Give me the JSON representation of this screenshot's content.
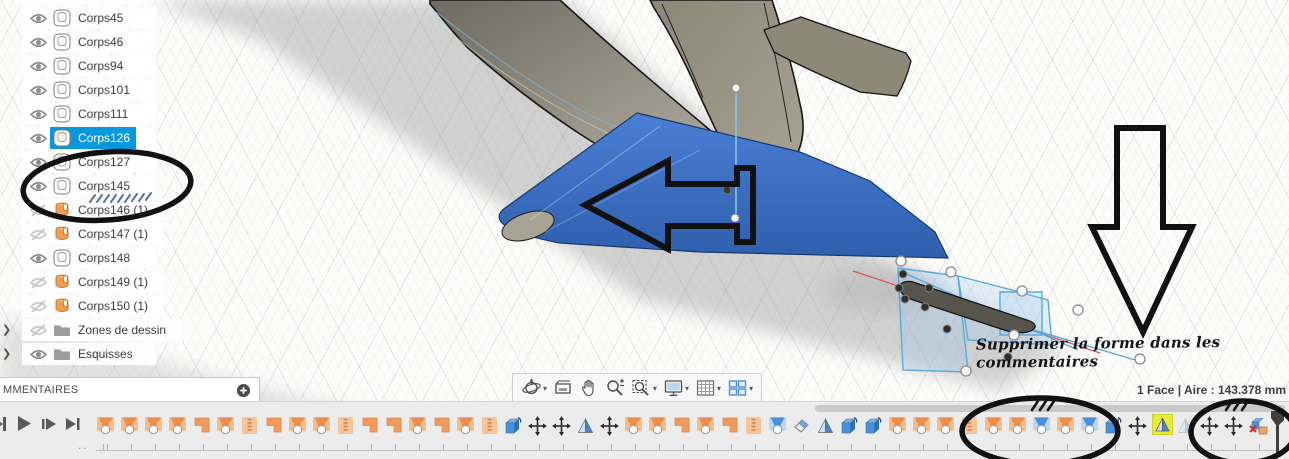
{
  "app": "Fusion 360 viewport",
  "browser": {
    "items": [
      {
        "label": "Corps45",
        "icon": "body-white",
        "eye": "on",
        "selected": false,
        "folder": false
      },
      {
        "label": "Corps46",
        "icon": "body-white",
        "eye": "on",
        "selected": false,
        "folder": false
      },
      {
        "label": "Corps94",
        "icon": "body-white",
        "eye": "on",
        "selected": false,
        "folder": false
      },
      {
        "label": "Corps101",
        "icon": "body-white",
        "eye": "on",
        "selected": false,
        "folder": false
      },
      {
        "label": "Corps111",
        "icon": "body-white",
        "eye": "on",
        "selected": false,
        "folder": false
      },
      {
        "label": "Corps126",
        "icon": "body-white",
        "eye": "on",
        "selected": true,
        "folder": false
      },
      {
        "label": "Corps127",
        "icon": "body-white",
        "eye": "on",
        "selected": false,
        "folder": false
      },
      {
        "label": "Corps145",
        "icon": "body-white",
        "eye": "on",
        "selected": false,
        "folder": false
      },
      {
        "label": "Corps146 (1)",
        "icon": "body-orange",
        "eye": "off",
        "selected": false,
        "folder": false
      },
      {
        "label": "Corps147 (1)",
        "icon": "body-orange",
        "eye": "off",
        "selected": false,
        "folder": false
      },
      {
        "label": "Corps148",
        "icon": "body-white",
        "eye": "on",
        "selected": false,
        "folder": false
      },
      {
        "label": "Corps149 (1)",
        "icon": "body-orange",
        "eye": "off",
        "selected": false,
        "folder": false
      },
      {
        "label": "Corps150 (1)",
        "icon": "body-orange",
        "eye": "off",
        "selected": false,
        "folder": false
      },
      {
        "label": "Zones de dessin",
        "icon": "folder",
        "eye": "off",
        "selected": false,
        "folder": true
      },
      {
        "label": "Esquisses",
        "icon": "folder",
        "eye": "on",
        "selected": false,
        "folder": true
      }
    ]
  },
  "comments_panel": {
    "title": "MMENTAIRES",
    "add_button": "plus-circle-icon"
  },
  "playback": [
    {
      "name": "skip-start"
    },
    {
      "name": "play"
    },
    {
      "name": "step-forward"
    },
    {
      "name": "skip-end"
    }
  ],
  "nav_toolbar": [
    {
      "name": "orbit",
      "caret": true
    },
    {
      "name": "look-at",
      "caret": false
    },
    {
      "name": "pan",
      "caret": false
    },
    {
      "name": "zoom",
      "caret": false
    },
    {
      "name": "fit",
      "caret": true
    },
    {
      "name": "display-settings",
      "caret": true
    },
    {
      "name": "grid-settings",
      "caret": true
    },
    {
      "name": "viewports",
      "caret": true
    }
  ],
  "timeline": {
    "sequence": [
      "form",
      "form",
      "form",
      "form",
      "corner",
      "form",
      "edge",
      "corner",
      "form",
      "form",
      "edge",
      "corner",
      "corner",
      "form",
      "corner",
      "form",
      "edge",
      "bluebox",
      "move",
      "move",
      "mirror",
      "move",
      "form",
      "form",
      "corner",
      "form",
      "corner",
      "edge",
      "blueform",
      "eraser",
      "mirror",
      "bluebox",
      "bluebox",
      "form",
      "form",
      "form",
      "edge",
      "form",
      "form",
      "blueform",
      "form",
      "blueform",
      "bluebox",
      "move",
      "mirror-warning",
      "mirror-disabled",
      "move",
      "move",
      "delete"
    ],
    "marker": "timeline-position-marker"
  },
  "status": {
    "selection_info": "1 Face | Aire : 143.378 mm"
  },
  "annotations": {
    "note": "Supprimer la forme dans les commentaires",
    "shapes": [
      "ellipse-browser-corps145",
      "ellipse-timeline-forms",
      "ellipse-timeline-end",
      "left-block-arrow",
      "down-block-arrow",
      "hatch-marks"
    ]
  },
  "colors": {
    "selection_blue": "#0998dd",
    "body_blue": "#3a6fc8",
    "timeline_orange": "#f2a469",
    "timeline_blue": "#4a90d9",
    "warning_yellow": "#e8ea3a",
    "annotation_black": "#111111",
    "construction_red": "#e05252",
    "sketch_blue": "#59a8dc"
  }
}
